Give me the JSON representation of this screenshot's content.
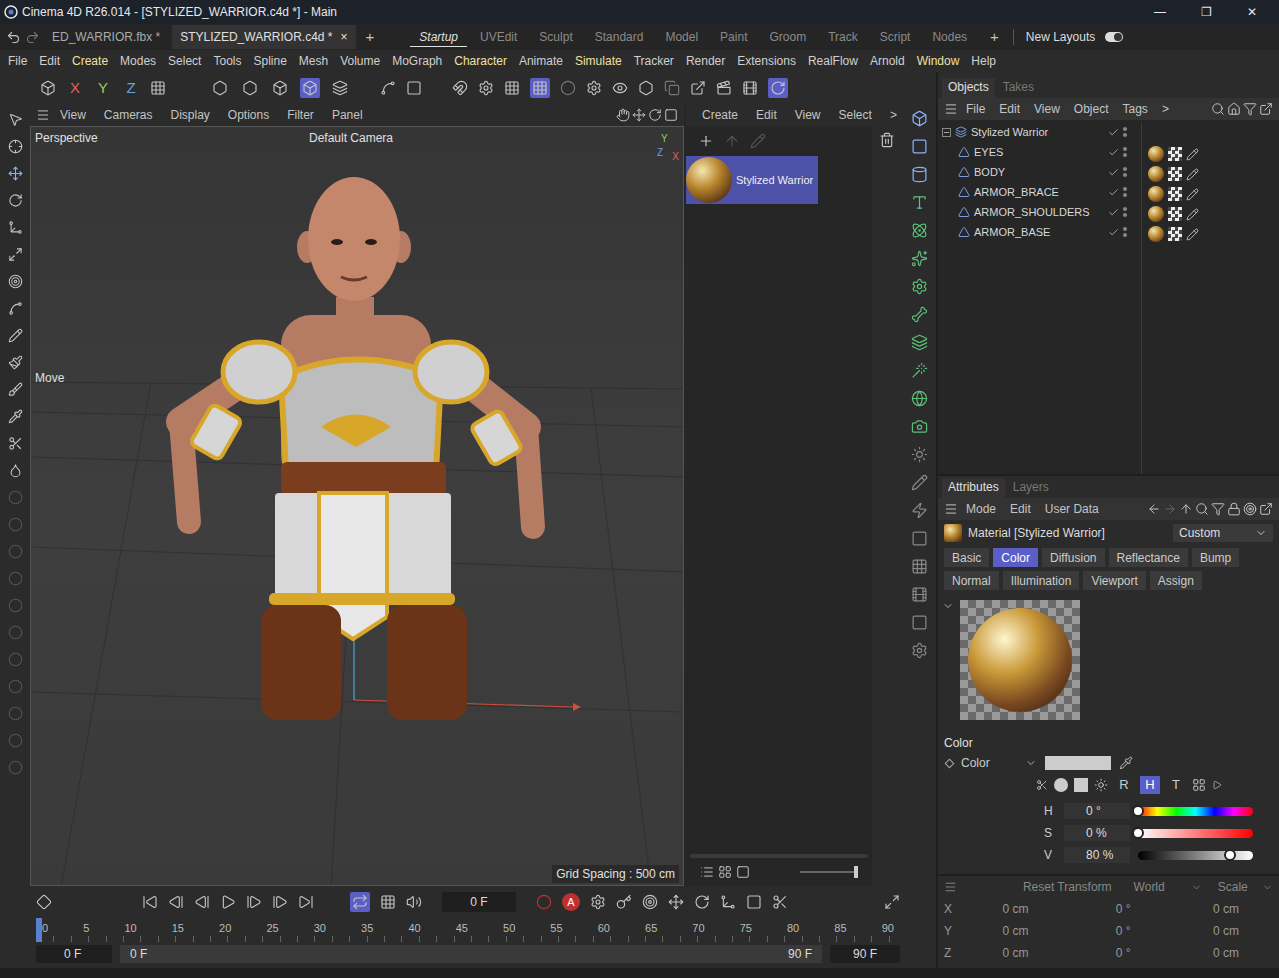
{
  "window": {
    "title": "Cinema 4D R26.014 - [STYLIZED_WARRIOR.c4d *] - Main",
    "controls": [
      "—",
      "❐",
      "✕"
    ]
  },
  "document_tabs": [
    {
      "label": "ED_WARRIOR.fbx *",
      "selected": false
    },
    {
      "label": "STYLIZED_WARRIOR.c4d *",
      "selected": true
    }
  ],
  "close_tab": "×",
  "new_tab": "+",
  "layouts": [
    {
      "label": "Startup",
      "selected": true
    },
    {
      "label": "UVEdit",
      "selected": false
    },
    {
      "label": "Sculpt",
      "selected": false
    },
    {
      "label": "Standard",
      "selected": false
    },
    {
      "label": "Model",
      "selected": false
    },
    {
      "label": "Paint",
      "selected": false
    },
    {
      "label": "Groom",
      "selected": false
    },
    {
      "label": "Track",
      "selected": false
    },
    {
      "label": "Script",
      "selected": false
    },
    {
      "label": "Nodes",
      "selected": false
    }
  ],
  "add_layout": "+",
  "new_layouts": {
    "label": "New Layouts",
    "on": true
  },
  "menu": [
    {
      "label": "File",
      "accent": false
    },
    {
      "label": "Edit",
      "accent": false
    },
    {
      "label": "Create",
      "accent": true
    },
    {
      "label": "Modes",
      "accent": false
    },
    {
      "label": "Select",
      "accent": false
    },
    {
      "label": "Tools",
      "accent": false
    },
    {
      "label": "Spline",
      "accent": false
    },
    {
      "label": "Mesh",
      "accent": false
    },
    {
      "label": "Volume",
      "accent": false
    },
    {
      "label": "MoGraph",
      "accent": false
    },
    {
      "label": "Character",
      "accent": true
    },
    {
      "label": "Animate",
      "accent": false
    },
    {
      "label": "Simulate",
      "accent": true
    },
    {
      "label": "Tracker",
      "accent": false
    },
    {
      "label": "Render",
      "accent": false
    },
    {
      "label": "Extensions",
      "accent": false
    },
    {
      "label": "RealFlow",
      "accent": false
    },
    {
      "label": "Arnold",
      "accent": false
    },
    {
      "label": "Window",
      "accent": true
    },
    {
      "label": "Help",
      "accent": false
    }
  ],
  "toolbar_axes": [
    "X",
    "Y",
    "Z"
  ],
  "viewport": {
    "menu": [
      "View",
      "Cameras",
      "Display",
      "Options",
      "Filter",
      "Panel"
    ],
    "view_name": "Perspective",
    "camera": "Default Camera",
    "tool": "Move",
    "grid": "Grid Spacing : 500 cm",
    "axis": [
      "Y",
      "Z",
      "X"
    ]
  },
  "material_manager": {
    "menu": [
      "Create",
      "Edit",
      "View",
      "Select",
      ">"
    ],
    "materials": [
      {
        "name": "Stylized Warrior",
        "selected": true
      }
    ]
  },
  "objects_panel": {
    "tabs": [
      {
        "label": "Objects",
        "selected": true
      },
      {
        "label": "Takes",
        "selected": false
      }
    ],
    "menu": [
      "File",
      "Edit",
      "View",
      "Object",
      "Tags",
      ">"
    ],
    "tree": [
      {
        "name": "Stylized Warrior",
        "depth": 0,
        "expanded": true
      },
      {
        "name": "EYES",
        "depth": 1,
        "expanded": false
      },
      {
        "name": "BODY",
        "depth": 1,
        "expanded": false
      },
      {
        "name": "ARMOR_BRACE",
        "depth": 1,
        "expanded": false
      },
      {
        "name": "ARMOR_SHOULDERS",
        "depth": 1,
        "expanded": false
      },
      {
        "name": "ARMOR_BASE",
        "depth": 1,
        "expanded": false
      }
    ]
  },
  "attributes": {
    "tabs": [
      {
        "label": "Attributes",
        "selected": true
      },
      {
        "label": "Layers",
        "selected": false
      }
    ],
    "menu": [
      "Mode",
      "Edit",
      "User Data"
    ],
    "title": "Material [Stylized Warrior]",
    "preset": "Custom",
    "channel_tabs": [
      [
        {
          "label": "Basic",
          "selected": false
        },
        {
          "label": "Color",
          "selected": true
        },
        {
          "label": "Diffusion",
          "selected": false
        },
        {
          "label": "Reflectance",
          "selected": false
        },
        {
          "label": "Bump",
          "selected": false
        }
      ],
      [
        {
          "label": "Normal",
          "selected": false
        },
        {
          "label": "Illumination",
          "selected": false
        },
        {
          "label": "Viewport",
          "selected": false
        },
        {
          "label": "Assign",
          "selected": false
        }
      ]
    ],
    "section": "Color",
    "color_row": {
      "label": "Color",
      "swatch": "#cccccc"
    },
    "mode_buttons": [
      {
        "label": "R",
        "selected": false
      },
      {
        "label": "H",
        "selected": true
      },
      {
        "label": "T",
        "selected": false
      }
    ],
    "sliders": [
      {
        "name": "H",
        "value": "0 °",
        "level": 0,
        "kind": "hue"
      },
      {
        "name": "S",
        "value": "0 %",
        "level": 0,
        "kind": "saturation"
      },
      {
        "name": "V",
        "value": "80 %",
        "level": 0.8,
        "kind": "value"
      }
    ]
  },
  "coordinates": {
    "reset": "Reset Transform",
    "space": "World",
    "mode": "Scale",
    "rows": [
      {
        "axis": "X",
        "position": "0 cm",
        "rotation": "0 °",
        "scale": "0 cm"
      },
      {
        "axis": "Y",
        "position": "0 cm",
        "rotation": "0 °",
        "scale": "0 cm"
      },
      {
        "axis": "Z",
        "position": "0 cm",
        "rotation": "0 °",
        "scale": "0 cm"
      }
    ]
  },
  "timeline": {
    "record": "A",
    "current_frame": "0 F",
    "ruler": [
      "0",
      "5",
      "10",
      "15",
      "20",
      "25",
      "30",
      "35",
      "40",
      "45",
      "50",
      "55",
      "60",
      "65",
      "70",
      "75",
      "80",
      "85",
      "90"
    ],
    "playhead_level": 0,
    "start": "0 F",
    "range_start": "0 F",
    "range_end": "90 F",
    "end": "90 F"
  }
}
